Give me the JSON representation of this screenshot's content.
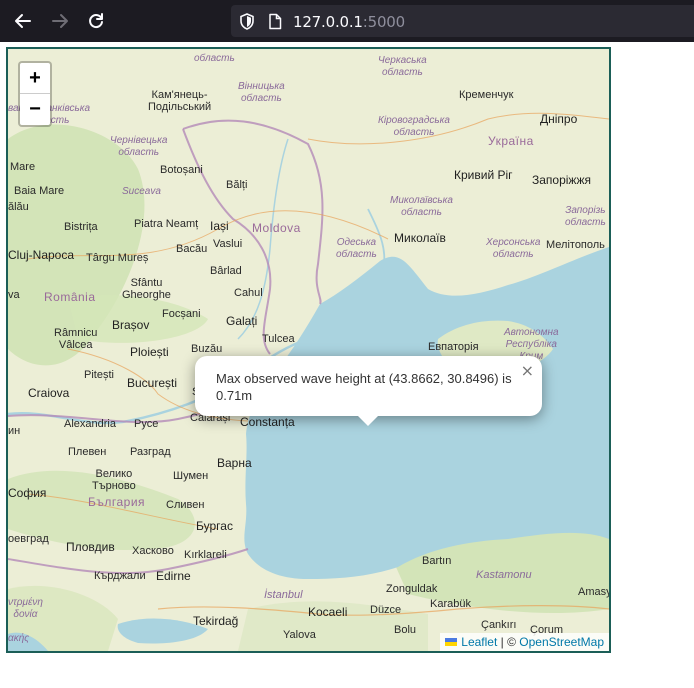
{
  "browser": {
    "url_host": "127.0.0.1",
    "url_port": ":5000"
  },
  "map": {
    "zoom_in": "+",
    "zoom_out": "−",
    "popup": {
      "text": "Max observed wave height at (43.8662, 30.8496) is 0.71m",
      "close": "×"
    },
    "attribution": {
      "leaflet": "Leaflet",
      "separator": " | © ",
      "osm": "OpenStreetMap"
    },
    "labels": {
      "oblast_top": "область",
      "cherkaska": "Черкаська\nобласть",
      "kamianets": "Кам'янець-\nПодільський",
      "vinnytska": "Вінницька\nобласть",
      "kremenchuk": "Кременчук",
      "ivano": "вано-Франківська\nобласть",
      "kirovohradska": "Кіровоградська\nобласть",
      "dnipro": "Дніпро",
      "ukraina": "Україна",
      "chernivetska": "Чернівецька\nобласть",
      "botosani": "Botoșani",
      "kryvyi": "Кривий Ріг",
      "zaporizhzhia": "Запоріжжя",
      "mare": "Mare",
      "balti": "Bălți",
      "suceava": "Suceava",
      "baia_mare": "Baia Mare",
      "mykolaivska": "Миколаївська\nобласть",
      "zaporizka": "Запорізь\nобласть",
      "alau": "ălău",
      "bistrita": "Bistrița",
      "piatra": "Piatra Neamț",
      "iasi": "Iași",
      "moldova": "Moldova",
      "odeska": "Одеська\nобласть",
      "mykolaiv": "Миколаїв",
      "khersonska": "Херсонська\nобласть",
      "melitopol": "Мелітополь",
      "cluj": "Cluj-Napoca",
      "targu": "Târgu Mureș",
      "bacau": "Bacău",
      "vaslui": "Vaslui",
      "sfantu": "Sfântu\nGheorghe",
      "barlad": "Bârlad",
      "va": "va",
      "romania": "România",
      "cahul": "Cahul",
      "focsani": "Focșani",
      "galati": "Galați",
      "brasov": "Brașov",
      "avtonomna": "Автономна\nРеспубліка\nКрим",
      "ramnicu": "Râmnicu\nVâlcea",
      "tulcea": "Tulcea",
      "yevpatoriia": "Евпаторія",
      "ploiesti": "Ploiești",
      "buzau": "Buzău",
      "pitesti": "Pitești",
      "bucuresti": "București",
      "craiova": "Craiova",
      "s": "S",
      "calarasi": "Călărași",
      "constanta": "Constanța",
      "alexandria": "Alexandria",
      "ruse": "Русе",
      "ain": "ин",
      "pleven": "Плевен",
      "razgrad": "Разград",
      "varna": "Варна",
      "veliko": "Велико\nТърново",
      "shumen": "Шумен",
      "sofia": "София",
      "bulgaria": "България",
      "sliven": "Сливен",
      "burgas": "Бургас",
      "oevgrad": "оевград",
      "plovdiv": "Пловдив",
      "haskovo": "Хасково",
      "kirklareli": "Kırklareli",
      "bartin": "Bartın",
      "kastamonu": "Kastamonu",
      "kardzhali": "Кърджали",
      "edirne": "Edirne",
      "zonguldak": "Zonguldak",
      "karabuk": "Karabük",
      "istanbul": "İstanbul",
      "amasy": "Amasy",
      "kocaeli": "Kocaeli",
      "duzce": "Düzce",
      "cankiri": "Çankırı",
      "tekirdag": "Tekirdağ",
      "yalova": "Yalova",
      "bolu": "Bolu",
      "corum": "Çorum",
      "dytiki": "ντρμένη\nδονία",
      "ellas": "ακής"
    }
  }
}
